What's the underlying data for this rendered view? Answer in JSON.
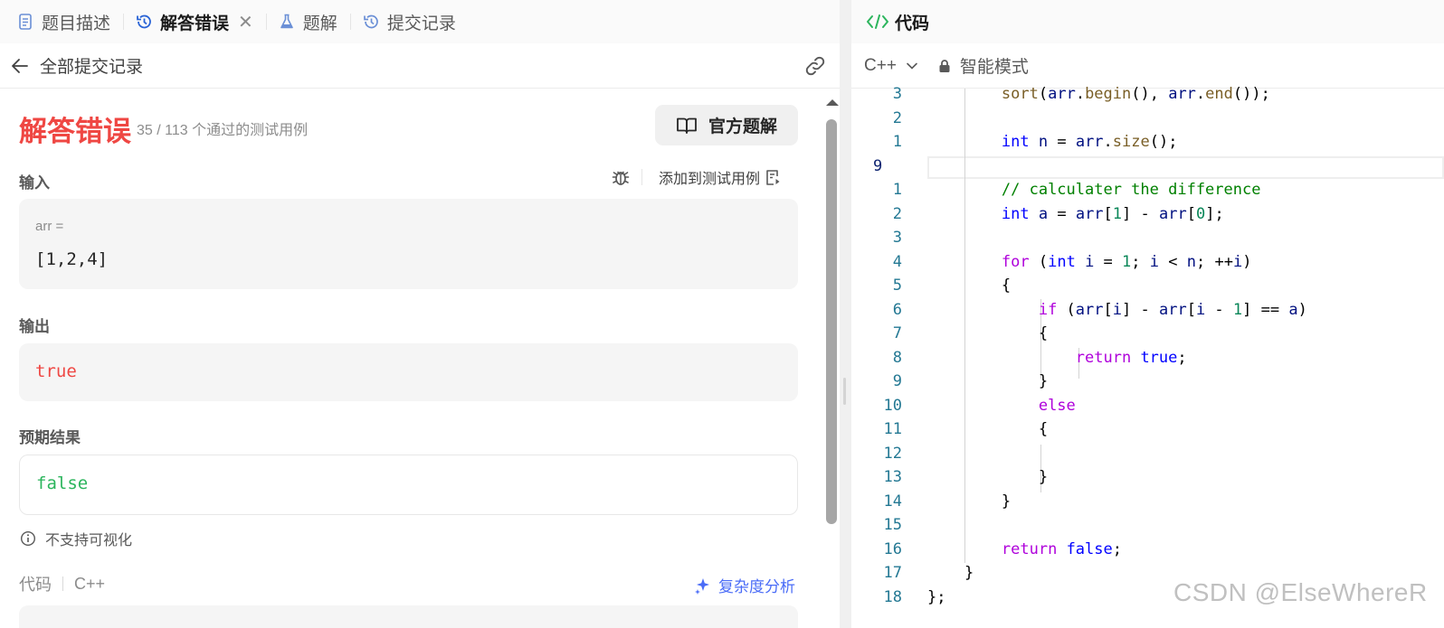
{
  "tabs": [
    {
      "label": "题目描述",
      "icon": "document-icon",
      "active": false
    },
    {
      "label": "解答错误",
      "icon": "history-icon",
      "active": true,
      "closable": true
    },
    {
      "label": "题解",
      "icon": "flask-icon",
      "active": false
    },
    {
      "label": "提交记录",
      "icon": "history-icon",
      "active": false
    }
  ],
  "subbar": {
    "back_label": "全部提交记录"
  },
  "result": {
    "status": "解答错误",
    "passed": "35 / 113 个通过的测试用例",
    "official_solution": "官方题解",
    "input_label": "输入",
    "add_testcase": "添加到测试用例",
    "input_var": "arr =",
    "input_value": "[1,2,4]",
    "output_label": "输出",
    "output_value": "true",
    "expected_label": "预期结果",
    "expected_value": "false",
    "no_visual": "不支持可视化",
    "code_label": "代码",
    "code_lang": "C++",
    "complexity": "复杂度分析"
  },
  "editor_header": {
    "title": "代码",
    "language": "C++",
    "mode": "智能模式"
  },
  "watermark": "CSDN @ElseWhereR",
  "colors": {
    "error": "#ef4743",
    "success": "#2cb55d",
    "accent": "#4a6cf7",
    "keyword": "#0000ff",
    "control": "#af00db"
  },
  "code_lines": [
    {
      "num": "3",
      "tokens": [
        [
          "        ",
          ""
        ],
        [
          "sort",
          "f"
        ],
        [
          "(",
          ""
        ],
        [
          "arr",
          "v"
        ],
        [
          ".",
          ""
        ],
        [
          "begin",
          "f"
        ],
        [
          "(), ",
          ""
        ],
        [
          "arr",
          "v"
        ],
        [
          ".",
          ""
        ],
        [
          "end",
          "f"
        ],
        [
          "());",
          ""
        ]
      ]
    },
    {
      "num": "2",
      "tokens": []
    },
    {
      "num": "1",
      "tokens": [
        [
          "        ",
          ""
        ],
        [
          "int",
          "k"
        ],
        [
          " ",
          ""
        ],
        [
          "n",
          "v"
        ],
        [
          " = ",
          ""
        ],
        [
          "arr",
          "v"
        ],
        [
          ".",
          ""
        ],
        [
          "size",
          "f"
        ],
        [
          "();",
          ""
        ]
      ]
    },
    {
      "num": "9",
      "current": true,
      "tokens": []
    },
    {
      "num": "1",
      "tokens": [
        [
          "        ",
          ""
        ],
        [
          "// calculater the difference",
          "cm"
        ]
      ]
    },
    {
      "num": "2",
      "tokens": [
        [
          "        ",
          ""
        ],
        [
          "int",
          "k"
        ],
        [
          " ",
          ""
        ],
        [
          "a",
          "v"
        ],
        [
          " = ",
          ""
        ],
        [
          "arr",
          "v"
        ],
        [
          "[",
          ""
        ],
        [
          "1",
          "n"
        ],
        [
          "] - ",
          ""
        ],
        [
          "arr",
          "v"
        ],
        [
          "[",
          ""
        ],
        [
          "0",
          "n"
        ],
        [
          "];",
          ""
        ]
      ]
    },
    {
      "num": "3",
      "tokens": []
    },
    {
      "num": "4",
      "tokens": [
        [
          "        ",
          ""
        ],
        [
          "for",
          "c"
        ],
        [
          " (",
          ""
        ],
        [
          "int",
          "k"
        ],
        [
          " ",
          ""
        ],
        [
          "i",
          "v"
        ],
        [
          " = ",
          ""
        ],
        [
          "1",
          "n"
        ],
        [
          "; ",
          ""
        ],
        [
          "i",
          "v"
        ],
        [
          " < ",
          ""
        ],
        [
          "n",
          "v"
        ],
        [
          "; ++",
          ""
        ],
        [
          "i",
          "v"
        ],
        [
          ")",
          ""
        ]
      ]
    },
    {
      "num": "5",
      "tokens": [
        [
          "        {",
          ""
        ]
      ]
    },
    {
      "num": "6",
      "tokens": [
        [
          "            ",
          ""
        ],
        [
          "if",
          "c"
        ],
        [
          " (",
          ""
        ],
        [
          "arr",
          "v"
        ],
        [
          "[",
          ""
        ],
        [
          "i",
          "v"
        ],
        [
          "] - ",
          ""
        ],
        [
          "arr",
          "v"
        ],
        [
          "[",
          ""
        ],
        [
          "i",
          "v"
        ],
        [
          " - ",
          ""
        ],
        [
          "1",
          "n"
        ],
        [
          "] == ",
          ""
        ],
        [
          "a",
          "v"
        ],
        [
          ")",
          ""
        ]
      ]
    },
    {
      "num": "7",
      "tokens": [
        [
          "            {",
          ""
        ]
      ]
    },
    {
      "num": "8",
      "tokens": [
        [
          "                ",
          ""
        ],
        [
          "return",
          "c"
        ],
        [
          " ",
          ""
        ],
        [
          "true",
          "k"
        ],
        [
          ";",
          ""
        ]
      ]
    },
    {
      "num": "9",
      "tokens": [
        [
          "            }",
          ""
        ]
      ]
    },
    {
      "num": "10",
      "tokens": [
        [
          "            ",
          ""
        ],
        [
          "else",
          "c"
        ]
      ]
    },
    {
      "num": "11",
      "tokens": [
        [
          "            {",
          ""
        ]
      ]
    },
    {
      "num": "12",
      "tokens": []
    },
    {
      "num": "13",
      "tokens": [
        [
          "            }",
          ""
        ]
      ]
    },
    {
      "num": "14",
      "tokens": [
        [
          "        }",
          ""
        ]
      ]
    },
    {
      "num": "15",
      "tokens": []
    },
    {
      "num": "16",
      "tokens": [
        [
          "        ",
          ""
        ],
        [
          "return",
          "c"
        ],
        [
          " ",
          ""
        ],
        [
          "false",
          "k"
        ],
        [
          ";",
          ""
        ]
      ]
    },
    {
      "num": "17",
      "tokens": [
        [
          "    }",
          ""
        ]
      ]
    },
    {
      "num": "18",
      "tokens": [
        [
          "};",
          ""
        ]
      ]
    }
  ]
}
